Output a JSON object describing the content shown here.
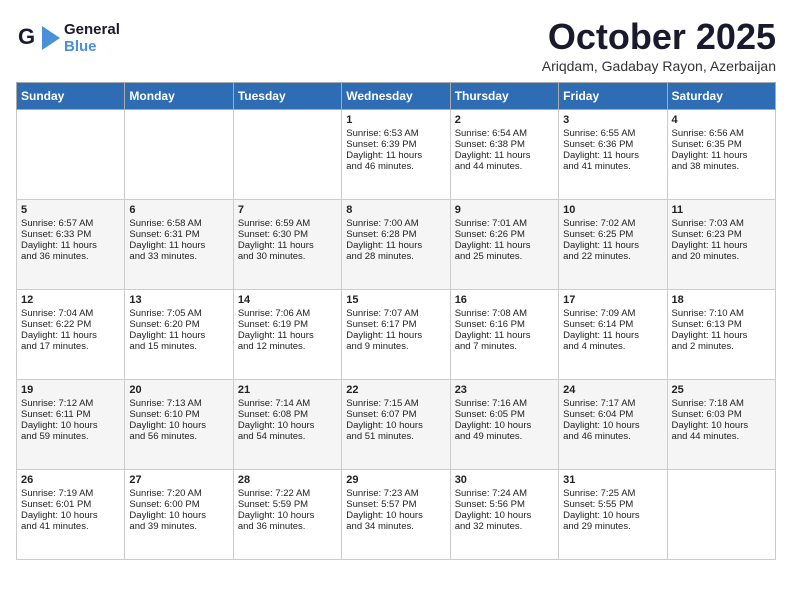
{
  "header": {
    "logo_general": "General",
    "logo_blue": "Blue",
    "month_title": "October 2025",
    "subtitle": "Ariqdam, Gadabay Rayon, Azerbaijan"
  },
  "weekdays": [
    "Sunday",
    "Monday",
    "Tuesday",
    "Wednesday",
    "Thursday",
    "Friday",
    "Saturday"
  ],
  "weeks": [
    [
      {
        "day": "",
        "text": ""
      },
      {
        "day": "",
        "text": ""
      },
      {
        "day": "",
        "text": ""
      },
      {
        "day": "1",
        "text": "Sunrise: 6:53 AM\nSunset: 6:39 PM\nDaylight: 11 hours\nand 46 minutes."
      },
      {
        "day": "2",
        "text": "Sunrise: 6:54 AM\nSunset: 6:38 PM\nDaylight: 11 hours\nand 44 minutes."
      },
      {
        "day": "3",
        "text": "Sunrise: 6:55 AM\nSunset: 6:36 PM\nDaylight: 11 hours\nand 41 minutes."
      },
      {
        "day": "4",
        "text": "Sunrise: 6:56 AM\nSunset: 6:35 PM\nDaylight: 11 hours\nand 38 minutes."
      }
    ],
    [
      {
        "day": "5",
        "text": "Sunrise: 6:57 AM\nSunset: 6:33 PM\nDaylight: 11 hours\nand 36 minutes."
      },
      {
        "day": "6",
        "text": "Sunrise: 6:58 AM\nSunset: 6:31 PM\nDaylight: 11 hours\nand 33 minutes."
      },
      {
        "day": "7",
        "text": "Sunrise: 6:59 AM\nSunset: 6:30 PM\nDaylight: 11 hours\nand 30 minutes."
      },
      {
        "day": "8",
        "text": "Sunrise: 7:00 AM\nSunset: 6:28 PM\nDaylight: 11 hours\nand 28 minutes."
      },
      {
        "day": "9",
        "text": "Sunrise: 7:01 AM\nSunset: 6:26 PM\nDaylight: 11 hours\nand 25 minutes."
      },
      {
        "day": "10",
        "text": "Sunrise: 7:02 AM\nSunset: 6:25 PM\nDaylight: 11 hours\nand 22 minutes."
      },
      {
        "day": "11",
        "text": "Sunrise: 7:03 AM\nSunset: 6:23 PM\nDaylight: 11 hours\nand 20 minutes."
      }
    ],
    [
      {
        "day": "12",
        "text": "Sunrise: 7:04 AM\nSunset: 6:22 PM\nDaylight: 11 hours\nand 17 minutes."
      },
      {
        "day": "13",
        "text": "Sunrise: 7:05 AM\nSunset: 6:20 PM\nDaylight: 11 hours\nand 15 minutes."
      },
      {
        "day": "14",
        "text": "Sunrise: 7:06 AM\nSunset: 6:19 PM\nDaylight: 11 hours\nand 12 minutes."
      },
      {
        "day": "15",
        "text": "Sunrise: 7:07 AM\nSunset: 6:17 PM\nDaylight: 11 hours\nand 9 minutes."
      },
      {
        "day": "16",
        "text": "Sunrise: 7:08 AM\nSunset: 6:16 PM\nDaylight: 11 hours\nand 7 minutes."
      },
      {
        "day": "17",
        "text": "Sunrise: 7:09 AM\nSunset: 6:14 PM\nDaylight: 11 hours\nand 4 minutes."
      },
      {
        "day": "18",
        "text": "Sunrise: 7:10 AM\nSunset: 6:13 PM\nDaylight: 11 hours\nand 2 minutes."
      }
    ],
    [
      {
        "day": "19",
        "text": "Sunrise: 7:12 AM\nSunset: 6:11 PM\nDaylight: 10 hours\nand 59 minutes."
      },
      {
        "day": "20",
        "text": "Sunrise: 7:13 AM\nSunset: 6:10 PM\nDaylight: 10 hours\nand 56 minutes."
      },
      {
        "day": "21",
        "text": "Sunrise: 7:14 AM\nSunset: 6:08 PM\nDaylight: 10 hours\nand 54 minutes."
      },
      {
        "day": "22",
        "text": "Sunrise: 7:15 AM\nSunset: 6:07 PM\nDaylight: 10 hours\nand 51 minutes."
      },
      {
        "day": "23",
        "text": "Sunrise: 7:16 AM\nSunset: 6:05 PM\nDaylight: 10 hours\nand 49 minutes."
      },
      {
        "day": "24",
        "text": "Sunrise: 7:17 AM\nSunset: 6:04 PM\nDaylight: 10 hours\nand 46 minutes."
      },
      {
        "day": "25",
        "text": "Sunrise: 7:18 AM\nSunset: 6:03 PM\nDaylight: 10 hours\nand 44 minutes."
      }
    ],
    [
      {
        "day": "26",
        "text": "Sunrise: 7:19 AM\nSunset: 6:01 PM\nDaylight: 10 hours\nand 41 minutes."
      },
      {
        "day": "27",
        "text": "Sunrise: 7:20 AM\nSunset: 6:00 PM\nDaylight: 10 hours\nand 39 minutes."
      },
      {
        "day": "28",
        "text": "Sunrise: 7:22 AM\nSunset: 5:59 PM\nDaylight: 10 hours\nand 36 minutes."
      },
      {
        "day": "29",
        "text": "Sunrise: 7:23 AM\nSunset: 5:57 PM\nDaylight: 10 hours\nand 34 minutes."
      },
      {
        "day": "30",
        "text": "Sunrise: 7:24 AM\nSunset: 5:56 PM\nDaylight: 10 hours\nand 32 minutes."
      },
      {
        "day": "31",
        "text": "Sunrise: 7:25 AM\nSunset: 5:55 PM\nDaylight: 10 hours\nand 29 minutes."
      },
      {
        "day": "",
        "text": ""
      }
    ]
  ]
}
